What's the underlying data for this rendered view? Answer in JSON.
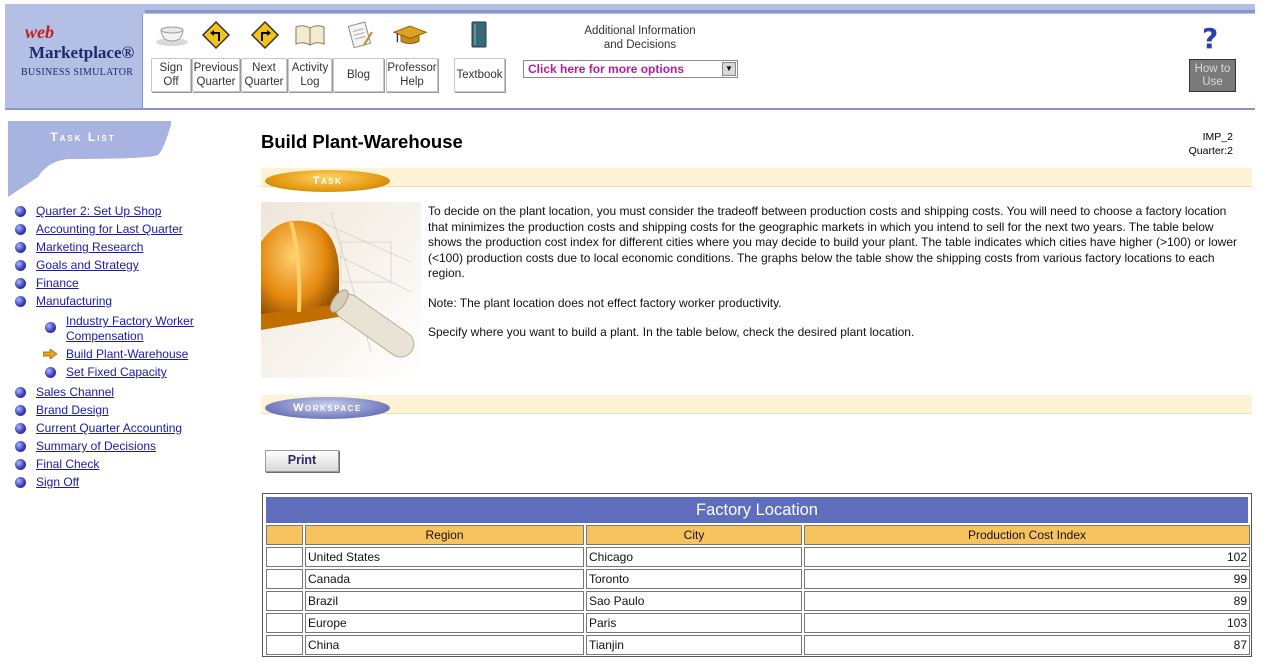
{
  "brand": {
    "logo_web": "web",
    "logo_marketplace": "Marketplace®",
    "logo_subtitle": "BUSINESS SIMULATOR"
  },
  "toolbar": {
    "buttons": [
      {
        "label": "Sign\nOff",
        "icon": "teacup-icon"
      },
      {
        "label": "Previous\nQuarter",
        "icon": "turn-left-sign-icon"
      },
      {
        "label": "Next\nQuarter",
        "icon": "turn-right-sign-icon"
      },
      {
        "label": "Activity\nLog",
        "icon": "open-book-icon"
      },
      {
        "label": "Blog",
        "icon": "notepad-icon"
      },
      {
        "label": "Professor\nHelp",
        "icon": "graduation-cap-icon"
      },
      {
        "label": "Textbook",
        "icon": "closed-book-icon"
      }
    ],
    "additional_info": "Additional Information\nand Decisions",
    "options_select": "Click here for more options",
    "how_to_use": "How to\nUse"
  },
  "sidebar": {
    "title": "Task List",
    "items": [
      {
        "label": "Quarter 2: Set Up Shop"
      },
      {
        "label": "Accounting for Last Quarter"
      },
      {
        "label": "Marketing Research"
      },
      {
        "label": "Goals and Strategy"
      },
      {
        "label": "Finance"
      },
      {
        "label": "Manufacturing"
      }
    ],
    "sub_items": [
      {
        "label": "Industry Factory Worker",
        "label2": "Compensation"
      },
      {
        "label": "Build Plant-Warehouse",
        "current": true
      },
      {
        "label": "Set Fixed Capacity"
      }
    ],
    "items_after": [
      {
        "label": "Sales Channel"
      },
      {
        "label": "Brand Design"
      },
      {
        "label": "Current Quarter Accounting"
      },
      {
        "label": "Summary of Decisions"
      },
      {
        "label": "Final Check"
      },
      {
        "label": "Sign Off"
      }
    ]
  },
  "page": {
    "title": "Build Plant-Warehouse",
    "meta": "IMP_2\nQuarter:2",
    "task_label": "Task",
    "workspace_label": "Workspace",
    "paragraphs": [
      "To decide on the plant location, you must consider the tradeoff between production costs and shipping costs. You will need to choose a factory location that minimizes the production costs and shipping costs for the geographic markets in which you intend to sell for the next two years. The table below shows the production cost index for different cities where you may decide to build your plant. The table indicates which cities have higher (>100) or lower (<100) production costs due to local economic conditions. The graphs below the table show the shipping costs from various factory locations to each region.",
      "Note: The plant location does not effect factory worker productivity.",
      "Specify where you want to build a plant. In the table below, check the desired plant location."
    ],
    "print_label": "Print"
  },
  "factory_table": {
    "title": "Factory Location",
    "headers": [
      "Region",
      "City",
      "Production Cost Index"
    ],
    "rows": [
      {
        "region": "United States",
        "city": "Chicago",
        "index": "102"
      },
      {
        "region": "Canada",
        "city": "Toronto",
        "index": "99"
      },
      {
        "region": "Brazil",
        "city": "Sao Paulo",
        "index": "89"
      },
      {
        "region": "Europe",
        "city": "Paris",
        "index": "103"
      },
      {
        "region": "China",
        "city": "Tianjin",
        "index": "87"
      }
    ]
  },
  "colors": {
    "header_bg": "#b4bfe6",
    "link": "#1a1aa8",
    "table_title_bg": "#5f6dbd",
    "table_header_bg": "#f7c35e",
    "section_bar_bg": "#fff3d6",
    "options_text": "#b0209a"
  }
}
